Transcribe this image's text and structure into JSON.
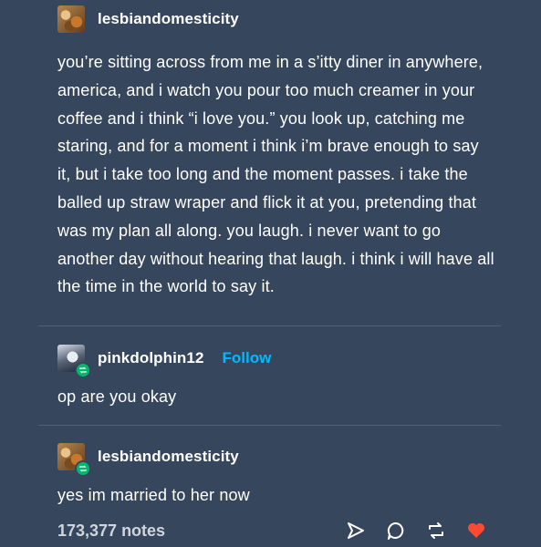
{
  "original_post": {
    "username": "lesbiandomesticity",
    "avatar_icon": "user-avatar",
    "text": "you’re sitting across from me in a s’itty diner in anywhere, america, and i watch you pour too much creamer in your coffee and i think “i love you.” you look up, catching me staring, and for a moment i think i’m brave enough to say it, but i take too long and the moment passes. i take the balled up straw wraper and flick it at you, pretending that was my plan all along. you laugh. i never want to go another day without hearing that laugh. i think i will have all the time in the world to say it."
  },
  "reblogs": [
    {
      "username": "pinkdolphin12",
      "follow_label": "Follow",
      "text": "op are you okay"
    },
    {
      "username": "lesbiandomesticity",
      "text": "yes im married to her now"
    }
  ],
  "footer": {
    "notes": "173,377 notes",
    "icons": [
      "share-icon",
      "reply-icon",
      "reblog-icon",
      "like-icon"
    ]
  },
  "colors": {
    "background": "#36465d",
    "follow": "#00b8ff",
    "reblog_badge": "#00b86b",
    "like": "#ff4930"
  }
}
